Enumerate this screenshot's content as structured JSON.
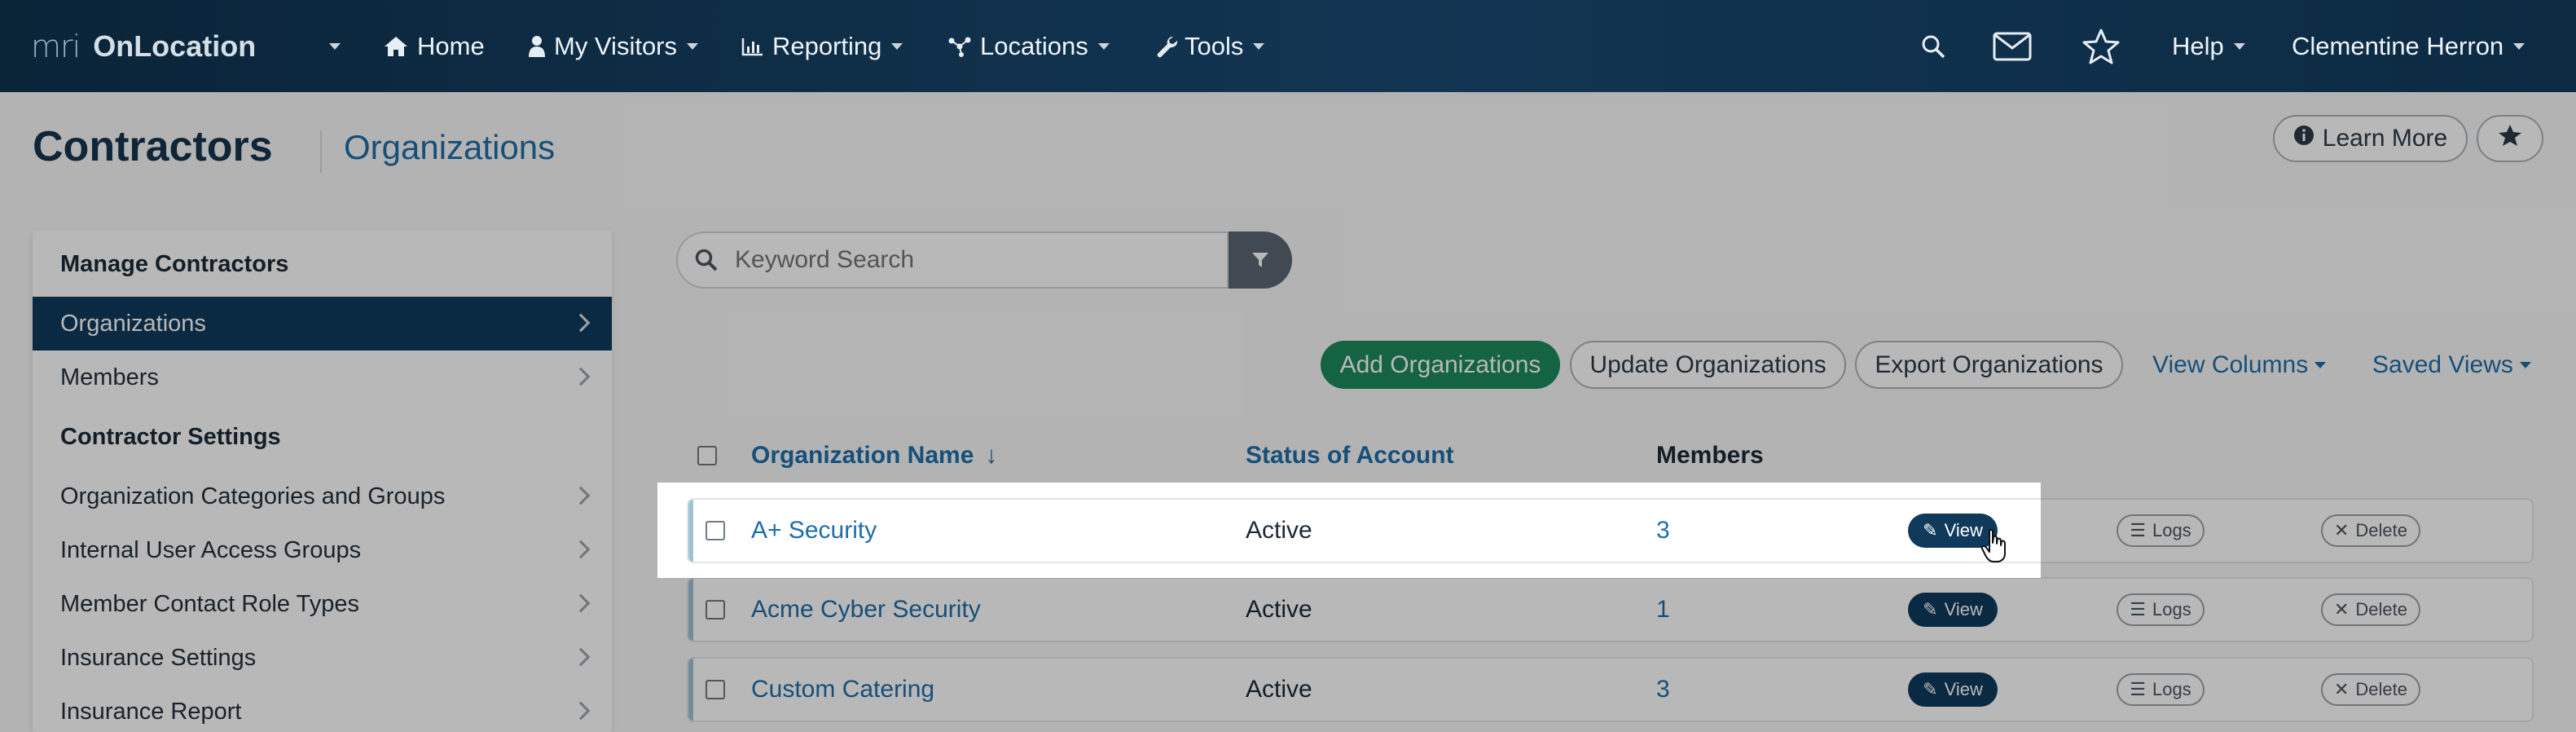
{
  "nav": {
    "logo_mark": "mri",
    "app_name": "OnLocation",
    "items": [
      {
        "label": "Home",
        "icon": "home-icon"
      },
      {
        "label": "My Visitors",
        "icon": "person-icon"
      },
      {
        "label": "Reporting",
        "icon": "bar-chart-icon"
      },
      {
        "label": "Locations",
        "icon": "network-icon"
      },
      {
        "label": "Tools",
        "icon": "wrench-icon"
      }
    ],
    "help_label": "Help",
    "user_name": "Clementine Herron"
  },
  "page": {
    "title": "Contractors",
    "subtitle": "Organizations",
    "learn_more_label": "Learn More"
  },
  "sidebar": {
    "section1_title": "Manage Contractors",
    "section2_title": "Contractor Settings",
    "items": [
      {
        "label": "Organizations",
        "active": true
      },
      {
        "label": "Members",
        "active": false
      },
      {
        "label": "Organization Categories and Groups",
        "active": false
      },
      {
        "label": "Internal User Access Groups",
        "active": false
      },
      {
        "label": "Member Contact Role Types",
        "active": false
      },
      {
        "label": "Insurance Settings",
        "active": false
      },
      {
        "label": "Insurance Report",
        "active": false
      }
    ]
  },
  "search": {
    "placeholder": "Keyword Search",
    "value": ""
  },
  "toolbar": {
    "add_label": "Add Organizations",
    "update_label": "Update Organizations",
    "export_label": "Export Organizations",
    "view_columns_label": "View Columns",
    "saved_views_label": "Saved Views"
  },
  "table": {
    "columns": {
      "name": "Organization Name",
      "sort_indicator": "↓",
      "status": "Status of Account",
      "members": "Members"
    },
    "rows": [
      {
        "name": "A+ Security",
        "status": "Active",
        "members": "3"
      },
      {
        "name": "Acme Cyber Security",
        "status": "Active",
        "members": "1"
      },
      {
        "name": "Custom Catering",
        "status": "Active",
        "members": "3"
      }
    ],
    "actions": {
      "view": "View",
      "logs": "Logs",
      "delete": "Delete"
    }
  },
  "colors": {
    "navbar": "#0c2a42",
    "accent_blue": "#1f6ea8",
    "primary_green": "#1d8a5c",
    "dark_button": "#0f3a5c"
  }
}
